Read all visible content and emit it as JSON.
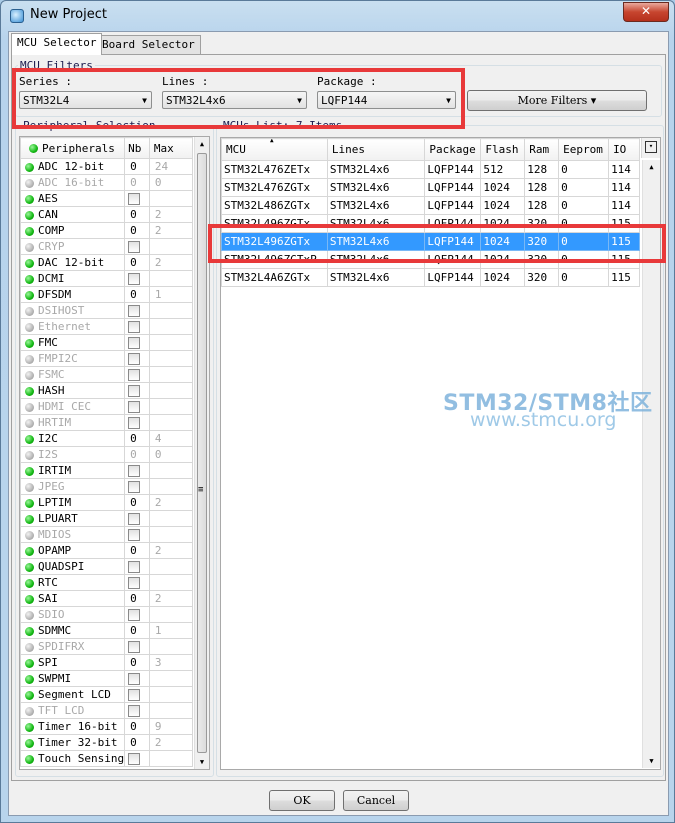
{
  "window": {
    "title": "New Project",
    "close_glyph": "✕"
  },
  "tabs": [
    {
      "label": "MCU Selector"
    },
    {
      "label": "Board Selector"
    }
  ],
  "filters": {
    "group_label": "MCU Filters",
    "series": {
      "label": "Series :",
      "value": "STM32L4"
    },
    "lines": {
      "label": "Lines :",
      "value": "STM32L4x6"
    },
    "package": {
      "label": "Package :",
      "value": "LQFP144"
    },
    "more_filters_label": "More Filters ▾"
  },
  "peripherals": {
    "group_label": "Peripheral Selection",
    "headers": {
      "name": "Peripherals",
      "nb": "Nb",
      "max": "Max"
    },
    "rows": [
      {
        "name": "ADC 12-bit",
        "nb": "0",
        "max": "24",
        "status": "on",
        "disabled": false,
        "max_disabled": true,
        "type": "num"
      },
      {
        "name": "ADC 16-bit",
        "nb": "0",
        "max": "0",
        "status": "off",
        "disabled": true,
        "max_disabled": true,
        "type": "num"
      },
      {
        "name": "AES",
        "status": "on",
        "disabled": false,
        "type": "check"
      },
      {
        "name": "CAN",
        "nb": "0",
        "max": "2",
        "status": "on",
        "disabled": false,
        "max_disabled": true,
        "type": "num"
      },
      {
        "name": "COMP",
        "nb": "0",
        "max": "2",
        "status": "on",
        "disabled": false,
        "max_disabled": true,
        "type": "num"
      },
      {
        "name": "CRYP",
        "status": "off",
        "disabled": true,
        "type": "check"
      },
      {
        "name": "DAC 12-bit",
        "nb": "0",
        "max": "2",
        "status": "on",
        "disabled": false,
        "max_disabled": true,
        "type": "num"
      },
      {
        "name": "DCMI",
        "status": "on",
        "disabled": false,
        "type": "check"
      },
      {
        "name": "DFSDM",
        "nb": "0",
        "max": "1",
        "status": "on",
        "disabled": false,
        "max_disabled": true,
        "type": "num"
      },
      {
        "name": "DSIHOST",
        "status": "off",
        "disabled": true,
        "type": "check"
      },
      {
        "name": "Ethernet",
        "status": "off",
        "disabled": true,
        "type": "check"
      },
      {
        "name": "FMC",
        "status": "on",
        "disabled": false,
        "type": "check"
      },
      {
        "name": "FMPI2C",
        "status": "off",
        "disabled": true,
        "type": "check"
      },
      {
        "name": "FSMC",
        "status": "off",
        "disabled": true,
        "type": "check"
      },
      {
        "name": "HASH",
        "status": "on",
        "disabled": false,
        "type": "check"
      },
      {
        "name": "HDMI CEC",
        "status": "off",
        "disabled": true,
        "type": "check"
      },
      {
        "name": "HRTIM",
        "status": "off",
        "disabled": true,
        "type": "check"
      },
      {
        "name": "I2C",
        "nb": "0",
        "max": "4",
        "status": "on",
        "disabled": false,
        "max_disabled": true,
        "type": "num"
      },
      {
        "name": "I2S",
        "nb": "0",
        "max": "0",
        "status": "off",
        "disabled": true,
        "max_disabled": true,
        "type": "num"
      },
      {
        "name": "IRTIM",
        "status": "on",
        "disabled": false,
        "type": "check"
      },
      {
        "name": "JPEG",
        "status": "off",
        "disabled": true,
        "type": "check"
      },
      {
        "name": "LPTIM",
        "nb": "0",
        "max": "2",
        "status": "on",
        "disabled": false,
        "max_disabled": true,
        "type": "num"
      },
      {
        "name": "LPUART",
        "status": "on",
        "disabled": false,
        "type": "check"
      },
      {
        "name": "MDIOS",
        "status": "off",
        "disabled": true,
        "type": "check"
      },
      {
        "name": "OPAMP",
        "nb": "0",
        "max": "2",
        "status": "on",
        "disabled": false,
        "max_disabled": true,
        "type": "num"
      },
      {
        "name": "QUADSPI",
        "status": "on",
        "disabled": false,
        "type": "check"
      },
      {
        "name": "RTC",
        "status": "on",
        "disabled": false,
        "type": "check"
      },
      {
        "name": "SAI",
        "nb": "0",
        "max": "2",
        "status": "on",
        "disabled": false,
        "max_disabled": true,
        "type": "num"
      },
      {
        "name": "SDIO",
        "status": "off",
        "disabled": true,
        "type": "check"
      },
      {
        "name": "SDMMC",
        "nb": "0",
        "max": "1",
        "status": "on",
        "disabled": false,
        "max_disabled": true,
        "type": "num"
      },
      {
        "name": "SPDIFRX",
        "status": "off",
        "disabled": true,
        "type": "check"
      },
      {
        "name": "SPI",
        "nb": "0",
        "max": "3",
        "status": "on",
        "disabled": false,
        "max_disabled": true,
        "type": "num"
      },
      {
        "name": "SWPMI",
        "status": "on",
        "disabled": false,
        "type": "check"
      },
      {
        "name": "Segment LCD",
        "status": "on",
        "disabled": false,
        "type": "check"
      },
      {
        "name": "TFT LCD",
        "status": "off",
        "disabled": true,
        "type": "check"
      },
      {
        "name": "Timer 16-bit",
        "nb": "0",
        "max": "9",
        "status": "on",
        "disabled": false,
        "max_disabled": true,
        "type": "num"
      },
      {
        "name": "Timer 32-bit",
        "nb": "0",
        "max": "2",
        "status": "on",
        "disabled": false,
        "max_disabled": true,
        "type": "num"
      },
      {
        "name": "Touch Sensing",
        "status": "on",
        "disabled": false,
        "type": "check"
      }
    ]
  },
  "mcus": {
    "group_label": "MCUs List: 7 Items",
    "headers": {
      "mcu": "MCU",
      "lines": "Lines",
      "package": "Package",
      "flash": "Flash",
      "ram": "Ram",
      "eeprom": "Eeprom",
      "io": "IO"
    },
    "sort_glyph": "▲",
    "rows": [
      {
        "mcu": "STM32L476ZETx",
        "lines": "STM32L4x6",
        "package": "LQFP144",
        "flash": "512",
        "ram": "128",
        "eeprom": "0",
        "io": "114",
        "selected": false
      },
      {
        "mcu": "STM32L476ZGTx",
        "lines": "STM32L4x6",
        "package": "LQFP144",
        "flash": "1024",
        "ram": "128",
        "eeprom": "0",
        "io": "114",
        "selected": false
      },
      {
        "mcu": "STM32L486ZGTx",
        "lines": "STM32L4x6",
        "package": "LQFP144",
        "flash": "1024",
        "ram": "128",
        "eeprom": "0",
        "io": "114",
        "selected": false
      },
      {
        "mcu": "STM32L496ZGTx",
        "lines": "STM32L4x6",
        "package": "LQFP144",
        "flash": "1024",
        "ram": "320",
        "eeprom": "0",
        "io": "115",
        "selected": false
      },
      {
        "mcu": "STM32L496ZGTx",
        "lines": "STM32L4x6",
        "package": "LQFP144",
        "flash": "1024",
        "ram": "320",
        "eeprom": "0",
        "io": "115",
        "selected": true
      },
      {
        "mcu": "STM32L496ZGTxP",
        "lines": "STM32L4x6",
        "package": "LQFP144",
        "flash": "1024",
        "ram": "320",
        "eeprom": "0",
        "io": "115",
        "selected": false
      },
      {
        "mcu": "STM32L4A6ZGTx",
        "lines": "STM32L4x6",
        "package": "LQFP144",
        "flash": "1024",
        "ram": "320",
        "eeprom": "0",
        "io": "115",
        "selected": false
      }
    ]
  },
  "buttons": {
    "ok": "OK",
    "cancel": "Cancel"
  },
  "watermark": {
    "line1": "STM32/STM8社区",
    "line2": "www.stmcu.org"
  },
  "colors": {
    "highlight_box": "#e8393a",
    "selection": "#3399ff",
    "status_on": "#12b812",
    "status_off": "#b5b5b5"
  }
}
